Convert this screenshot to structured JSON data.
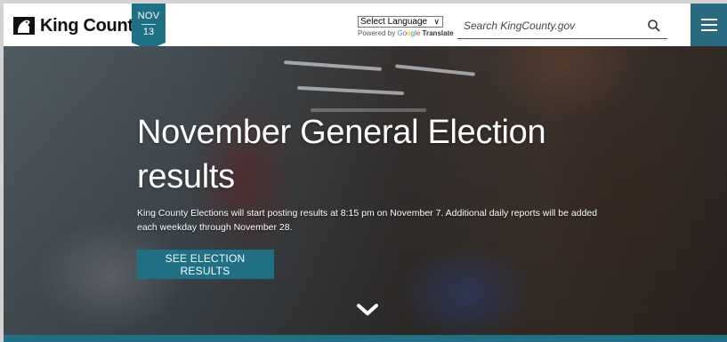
{
  "header": {
    "logo_text": "King County",
    "date_month": "NOV",
    "date_day": "13",
    "language_select": "Select Language",
    "powered_by": "Powered by",
    "google_letters": [
      "G",
      "o",
      "o",
      "g",
      "l",
      "e"
    ],
    "translate_label": "Translate",
    "search_placeholder": "Search KingCounty.gov",
    "icons": {
      "search": "search-icon",
      "menu": "hamburger-menu-icon",
      "logo": "king-county-logo-icon"
    }
  },
  "hero": {
    "title": "November General Election results",
    "description": "King County Elections will start posting results at 8:15 pm on November 7. Additional daily reports will be added each weekday through November 28.",
    "cta_label": "SEE ELECTION RESULTS",
    "scroll_icon": "chevron-down-icon"
  },
  "colors": {
    "accent": "#1f6f85",
    "menu_bg": "#2a6a80",
    "badge_bg": "#1f6f85"
  }
}
